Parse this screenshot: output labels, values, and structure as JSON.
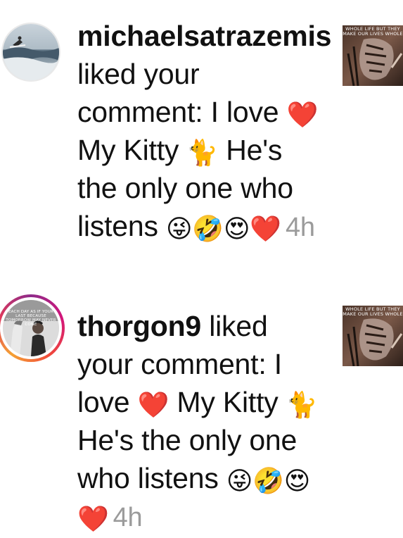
{
  "notifications": [
    {
      "username": "michaelsatrazemis",
      "action_text": " liked your comment: I love ",
      "mid_text": " My Kitty ",
      "tail_text": " He's the only one who listens ",
      "emoji_heart": "❤️",
      "emoji_cat": "🐈",
      "emoji_tail": [
        "😜",
        "🤣",
        "😍",
        "❤️"
      ],
      "time": "4h",
      "avatar_icon": "surfer-wave-photo",
      "thumb_caption": "WHOLE LIFE BUT THEY MAKE OUR LIVES WHOLE"
    },
    {
      "username": "thorgon9",
      "action_text": " liked your comment: I love ",
      "mid_text": " My Kitty ",
      "tail_text": " He's the only one who listens ",
      "emoji_heart": "❤️",
      "emoji_cat": "🐈",
      "emoji_tail": [
        "😜",
        "🤣",
        "😍",
        "❤️"
      ],
      "time": "4h",
      "avatar_icon": "man-with-horse-photo",
      "avatar_caption": "EACH DAY AS IF YOUR LAST BECAUSE TOMORROW MAY NEVER COME",
      "thumb_caption": "WHOLE LIFE BUT THEY MAKE OUR LIVES WHOLE"
    }
  ]
}
